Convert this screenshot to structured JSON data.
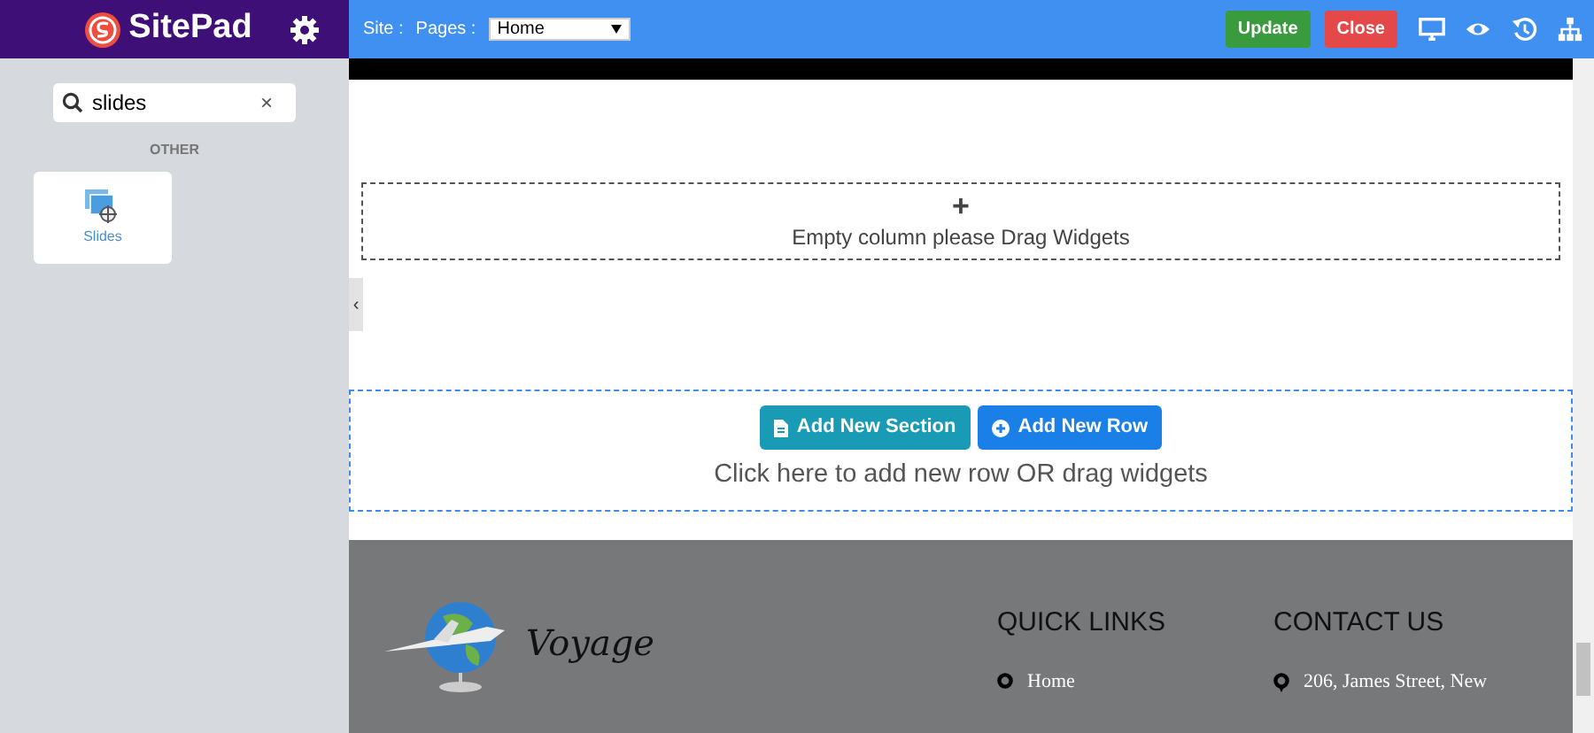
{
  "sidebar": {
    "logo": "SitePad",
    "search": {
      "value": "slides",
      "clear": "×"
    },
    "group_heading": "OTHER",
    "widgets": [
      {
        "label": "Slides",
        "selected": false
      }
    ],
    "collapse": "‹"
  },
  "toolbar": {
    "site_label": "Site :",
    "pages_label": "Pages :",
    "page_select": "Home",
    "buttons": [
      {
        "label": "Update",
        "kind": "update"
      },
      {
        "label": "Close",
        "kind": "close"
      }
    ],
    "icons": [
      {
        "kind": "desktop"
      },
      {
        "kind": "eye"
      },
      {
        "kind": "history"
      },
      {
        "kind": "sitemap"
      }
    ]
  },
  "canvas": {
    "empty_column": {
      "plus": "+",
      "text": "Empty column please Drag Widgets"
    },
    "add_row": {
      "buttons": [
        {
          "label": "Add New Section",
          "kind": "section"
        },
        {
          "label": "Add New Row",
          "kind": "row"
        }
      ],
      "hint": "Click here to add new row OR drag widgets"
    },
    "footer": {
      "logo_text": "Voyage",
      "columns": [
        {
          "heading": "QUICK LINKS",
          "items": [
            "Home"
          ]
        },
        {
          "heading": "CONTACT US",
          "items": [
            "206, James Street, New"
          ]
        }
      ]
    }
  }
}
